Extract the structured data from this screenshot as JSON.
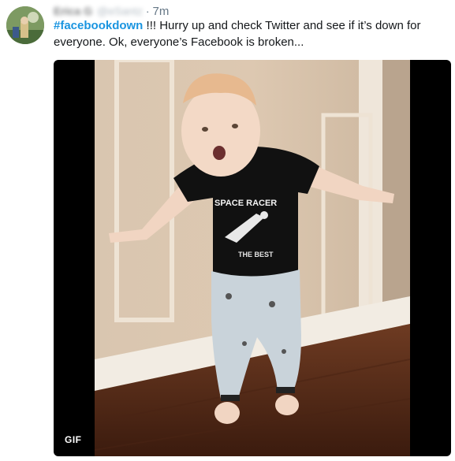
{
  "tweet": {
    "author_name": "Erica G",
    "author_handle": "@eSantz",
    "separator": "·",
    "timestamp": "7m",
    "hashtag": "#facebookdown",
    "text_after_hashtag": " !!! Hurry up and check Twitter and see if it’s down for everyone. Ok, everyone’s Facebook is broken..."
  },
  "media": {
    "badge": "GIF",
    "shirt_text_1": "SPACE RACER",
    "shirt_text_2": "THE BEST"
  },
  "colors": {
    "hashtag": "#1b95e0",
    "secondary_text": "#657786",
    "media_background": "#000000"
  }
}
